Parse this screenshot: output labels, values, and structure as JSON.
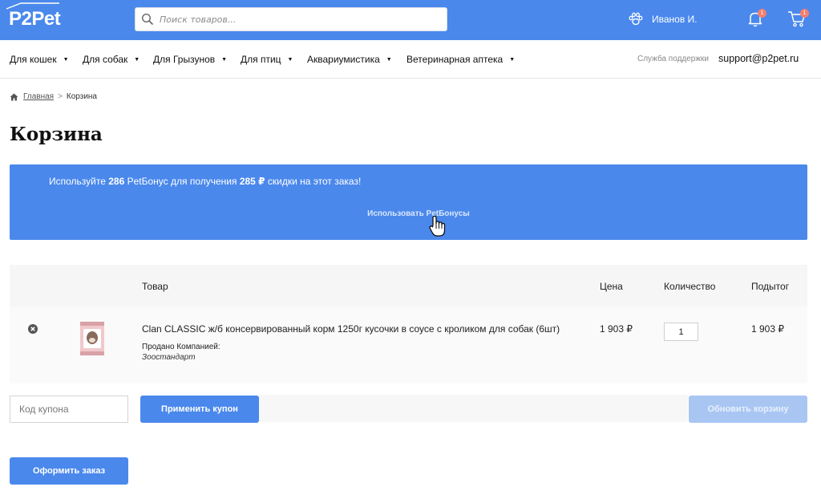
{
  "header": {
    "logo": "P2Pet",
    "search": {
      "placeholder": "Поиск товаров..."
    },
    "user_name": "Иванов И.",
    "notifications_count": "1",
    "cart_count": "1"
  },
  "nav": {
    "items": [
      {
        "label": "Для кошек"
      },
      {
        "label": "Для собак"
      },
      {
        "label": "Для Грызунов"
      },
      {
        "label": "Для птиц"
      },
      {
        "label": "Аквариумистика"
      },
      {
        "label": "Ветеринарная аптека"
      }
    ],
    "support_label": "Служба поддержки",
    "support_email": "support@p2pet.ru"
  },
  "breadcrumb": {
    "home": "Главная",
    "separator": ">",
    "current": "Корзина"
  },
  "page_title": "Корзина",
  "bonus": {
    "text_before": "Используйте ",
    "bonus_amount": "286",
    "text_middle": " PetБонус для получения ",
    "discount": "285 ₽",
    "text_after": " скидки на этот заказ!",
    "button_label": "Использовать PetБонусы"
  },
  "cart_table": {
    "columns": {
      "product": "Товар",
      "price": "Цена",
      "quantity": "Количество",
      "subtotal": "Подытог"
    },
    "rows": [
      {
        "name": "Clan CLASSIC ж/б консервированный корм 1250г кусочки в соусе с кроликом для собак (6шт)",
        "sold_by_label": "Продано Компанией:",
        "sold_by": "Зоостандарт",
        "price": "1 903 ₽",
        "quantity": "1",
        "subtotal": "1 903 ₽"
      }
    ]
  },
  "coupon": {
    "placeholder": "Код купона",
    "apply_label": "Применить купон",
    "update_label": "Обновить корзину"
  },
  "checkout_label": "Оформить заказ",
  "colors": {
    "brand_blue": "#4a88ec",
    "disabled_blue": "#a9c6f3",
    "badge": "#f57f6e"
  }
}
